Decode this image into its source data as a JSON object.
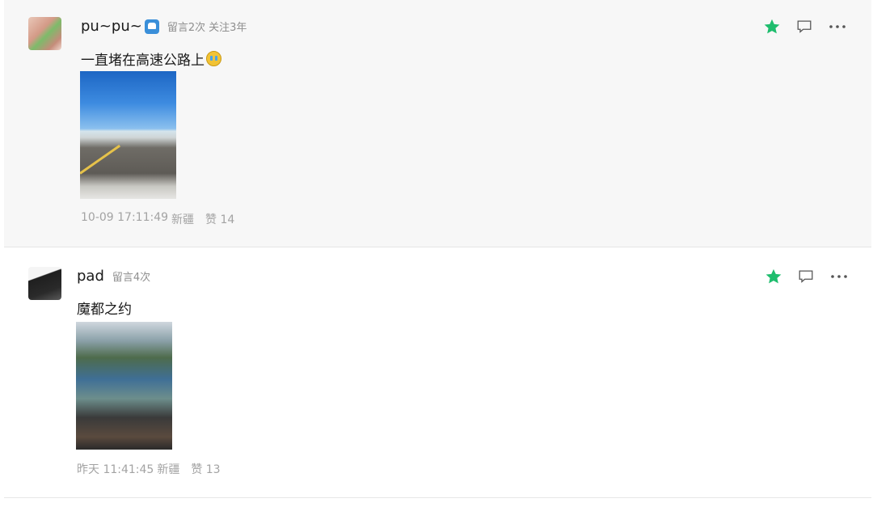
{
  "comments": [
    {
      "user": "pu~pu~",
      "user_emoji": "whale-emoji",
      "meta": [
        "留言2次",
        "关注3年"
      ],
      "text": "一直堵在高速公路上",
      "text_emoji": "crying-emoji",
      "photo": "highway-photo",
      "time": "10-09 17:11:49",
      "location": "新疆",
      "likes": "赞 14",
      "starred": true
    },
    {
      "user": "pad",
      "meta": [
        "留言4次"
      ],
      "text": "魔都之约",
      "photo": "street-selfie-photo",
      "time": "昨天 11:41:45",
      "location": "新疆",
      "likes": "赞 13",
      "starred": true
    }
  ],
  "colors": {
    "star": "#1fbd6e",
    "meta": "#8f8f8f",
    "footer": "#a3a3a3",
    "highlight_bg": "#f7f7f7"
  },
  "icons": [
    "star-icon",
    "comment-bubble-icon",
    "more-icon"
  ]
}
